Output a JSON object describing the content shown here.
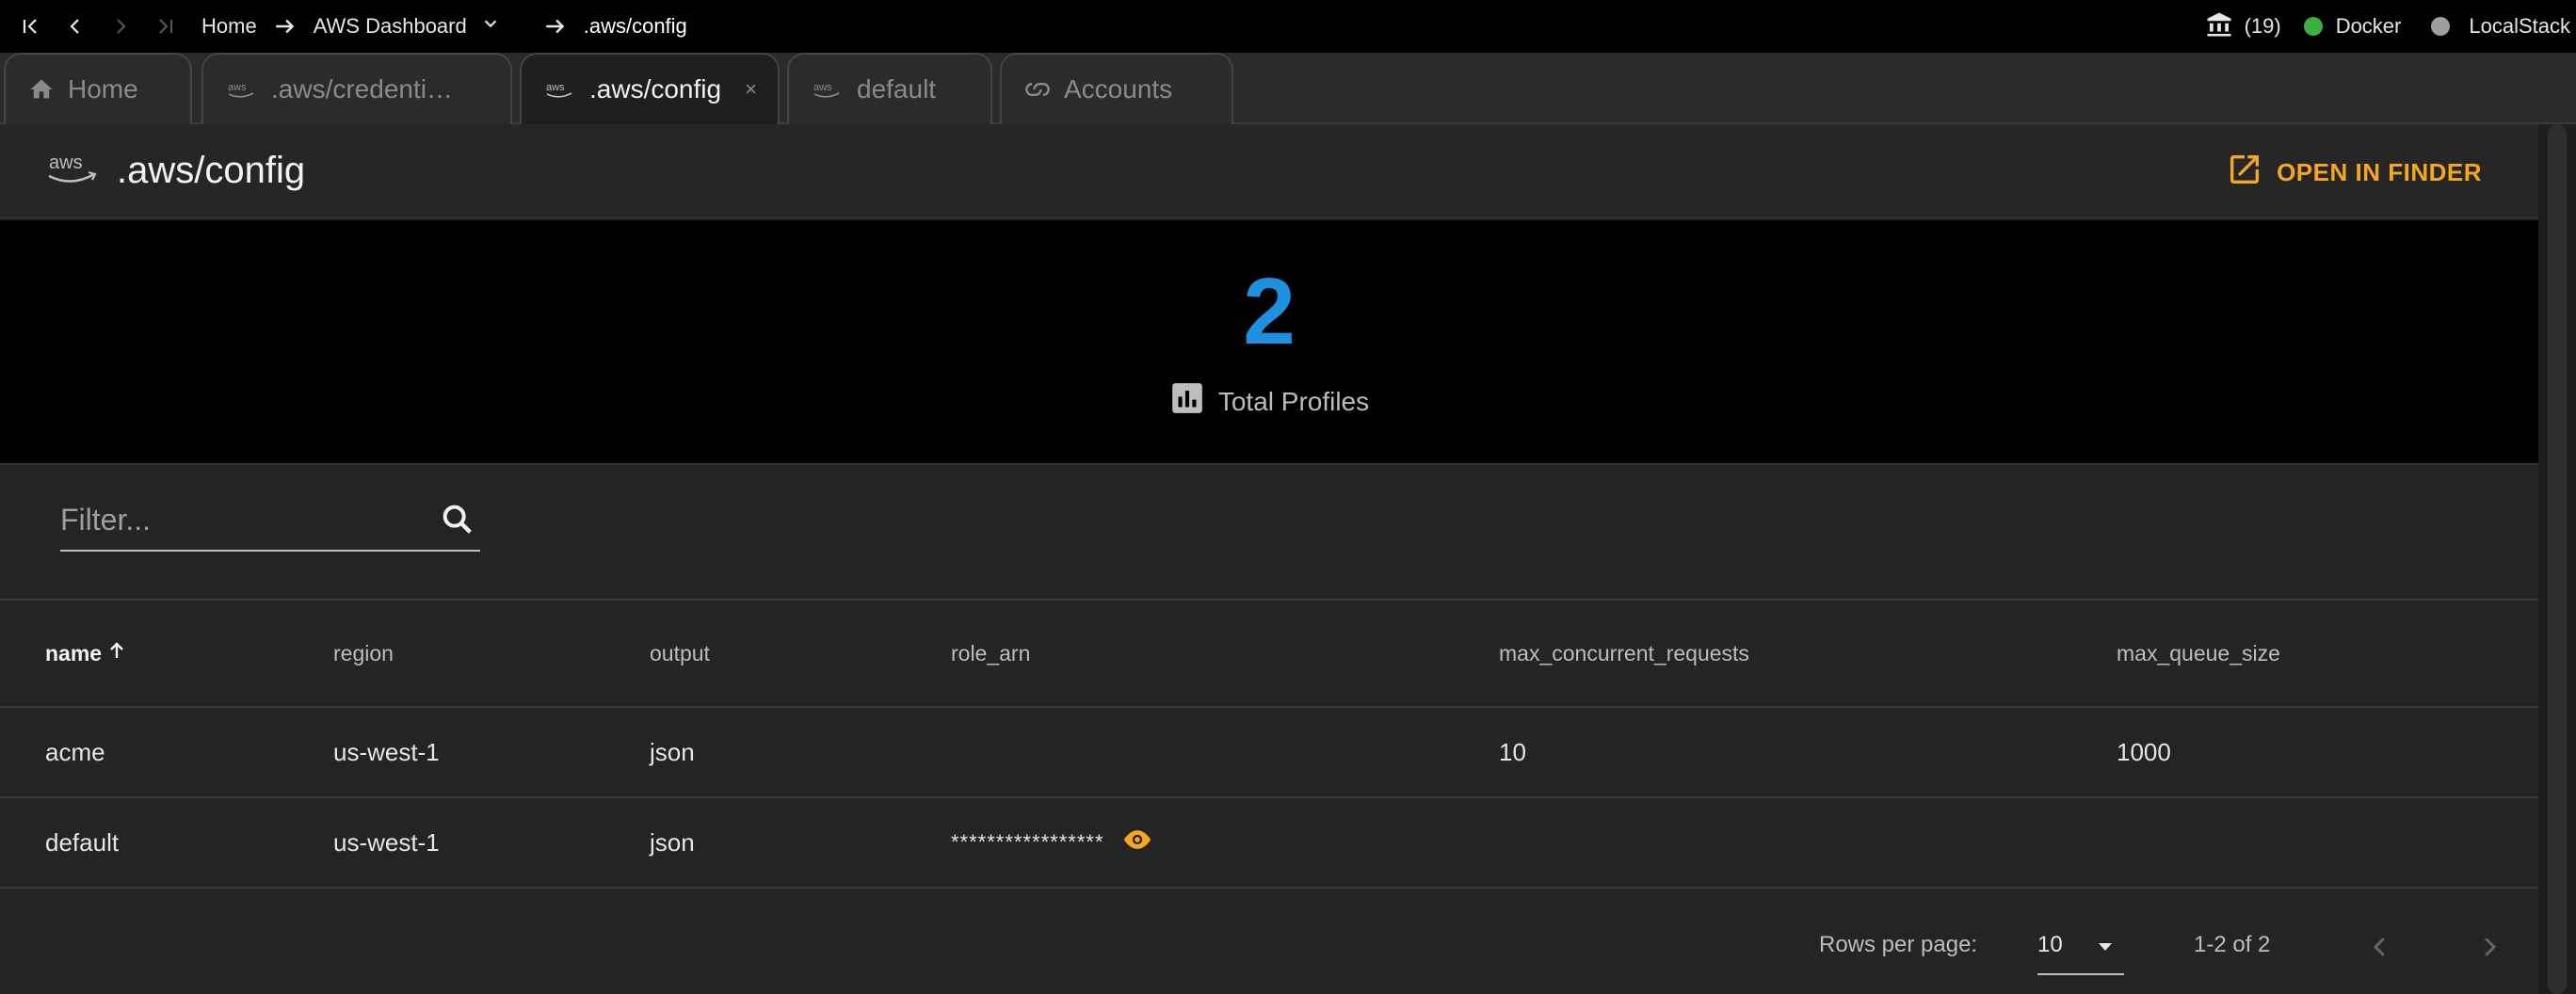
{
  "topbar": {
    "breadcrumbs": [
      "Home",
      "AWS Dashboard",
      ".aws/config"
    ],
    "bank_count": "(19)",
    "services": [
      {
        "name": "Docker",
        "status_color": "#3cb043"
      },
      {
        "name": "LocalStack",
        "status_color": "#9e9e9e"
      }
    ]
  },
  "tabs": [
    {
      "label": "Home",
      "icon": "home-icon"
    },
    {
      "label": ".aws/credenti…",
      "icon": "aws-icon"
    },
    {
      "label": ".aws/config",
      "icon": "aws-icon",
      "active": true,
      "close": "×"
    },
    {
      "label": "default",
      "icon": "aws-icon"
    },
    {
      "label": "Accounts",
      "icon": "link-icon"
    }
  ],
  "header": {
    "icon_text": "aws",
    "title": ".aws/config",
    "open_button": "OPEN IN FINDER"
  },
  "stats": {
    "value": "2",
    "label": "Total Profiles"
  },
  "filter": {
    "placeholder": "Filter...",
    "value": ""
  },
  "table": {
    "columns": [
      "name",
      "region",
      "output",
      "role_arn",
      "max_concurrent_requests",
      "max_queue_size"
    ],
    "sorted_column": "name",
    "rows": [
      {
        "name": "acme",
        "region": "us-west-1",
        "output": "json",
        "role_arn": "",
        "max_concurrent_requests": "10",
        "max_queue_size": "1000"
      },
      {
        "name": "default",
        "region": "us-west-1",
        "output": "json",
        "role_arn": "*****************",
        "max_concurrent_requests": "",
        "max_queue_size": ""
      }
    ]
  },
  "pagination": {
    "rows_per_page_label": "Rows per page:",
    "rows_per_page": "10",
    "range": "1-2 of 2"
  },
  "colors": {
    "accent": "#f5a623",
    "stat_value": "#1e90e0",
    "background": "#242424"
  }
}
